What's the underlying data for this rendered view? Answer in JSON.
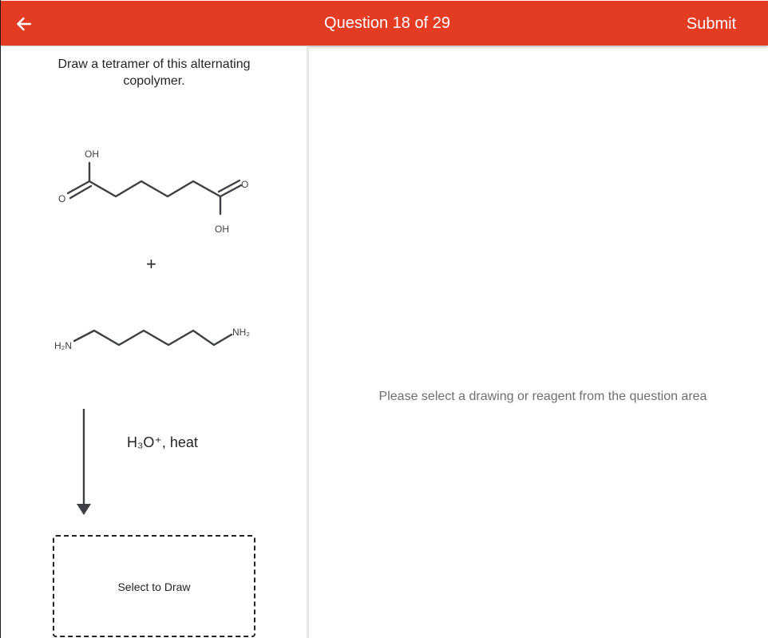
{
  "header": {
    "question_label": "Question 18 of 29",
    "submit_label": "Submit",
    "background_color": "#e43b23",
    "back_icon": "arrow-left-icon"
  },
  "question": {
    "prompt": "Draw a tetramer of this alternating copolymer.",
    "molecule_1": {
      "top_group": "OH",
      "left_oxygen": "O",
      "right_oxygen": "O",
      "bottom_group": "OH"
    },
    "plus_sign": "+",
    "molecule_2": {
      "left_group": "H₂N",
      "right_group": "NH₂"
    },
    "reagent": "H₃O⁺, heat",
    "answer_box_label": "Select to Draw"
  },
  "workspace": {
    "placeholder": "Please select a drawing or reagent from the question area"
  }
}
